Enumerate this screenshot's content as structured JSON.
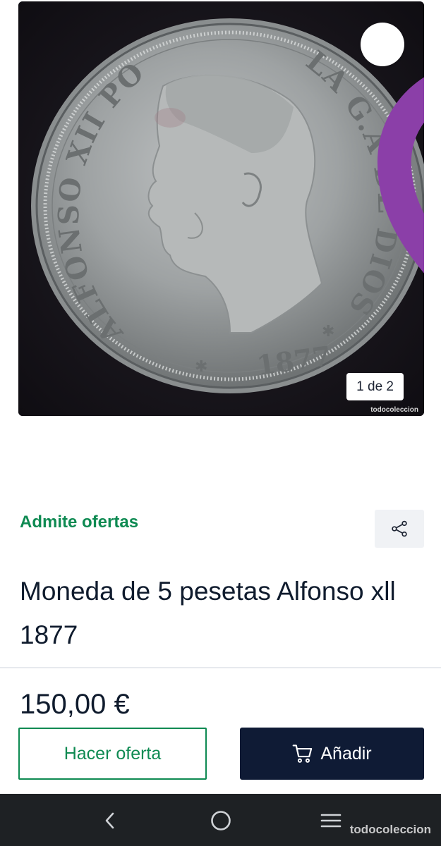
{
  "gallery": {
    "counter": "1 de 2",
    "watermark": "todocoleccion",
    "coin_legend_left": "ALFONSO XII POR",
    "coin_legend_right": "LA G.A DE DIOS",
    "coin_year": "1877"
  },
  "icons": {
    "favorite": "heart-icon",
    "share": "share-icon",
    "cart": "cart-icon",
    "nav_back": "chevron-left-icon",
    "nav_home": "circle-icon",
    "nav_recents": "menu-icon"
  },
  "listing": {
    "offers_label": "Admite ofertas",
    "title": "Moneda de 5 pesetas Alfonso xll 1877",
    "price": "150,00 €"
  },
  "actions": {
    "offer_label": "Hacer oferta",
    "add_label": "Añadir"
  },
  "system_bar": {
    "watermark": "todocoleccion"
  },
  "colors": {
    "accent_green": "#0e8a52",
    "primary_dark": "#0f1b35",
    "heart_purple": "#8b3fa8"
  }
}
